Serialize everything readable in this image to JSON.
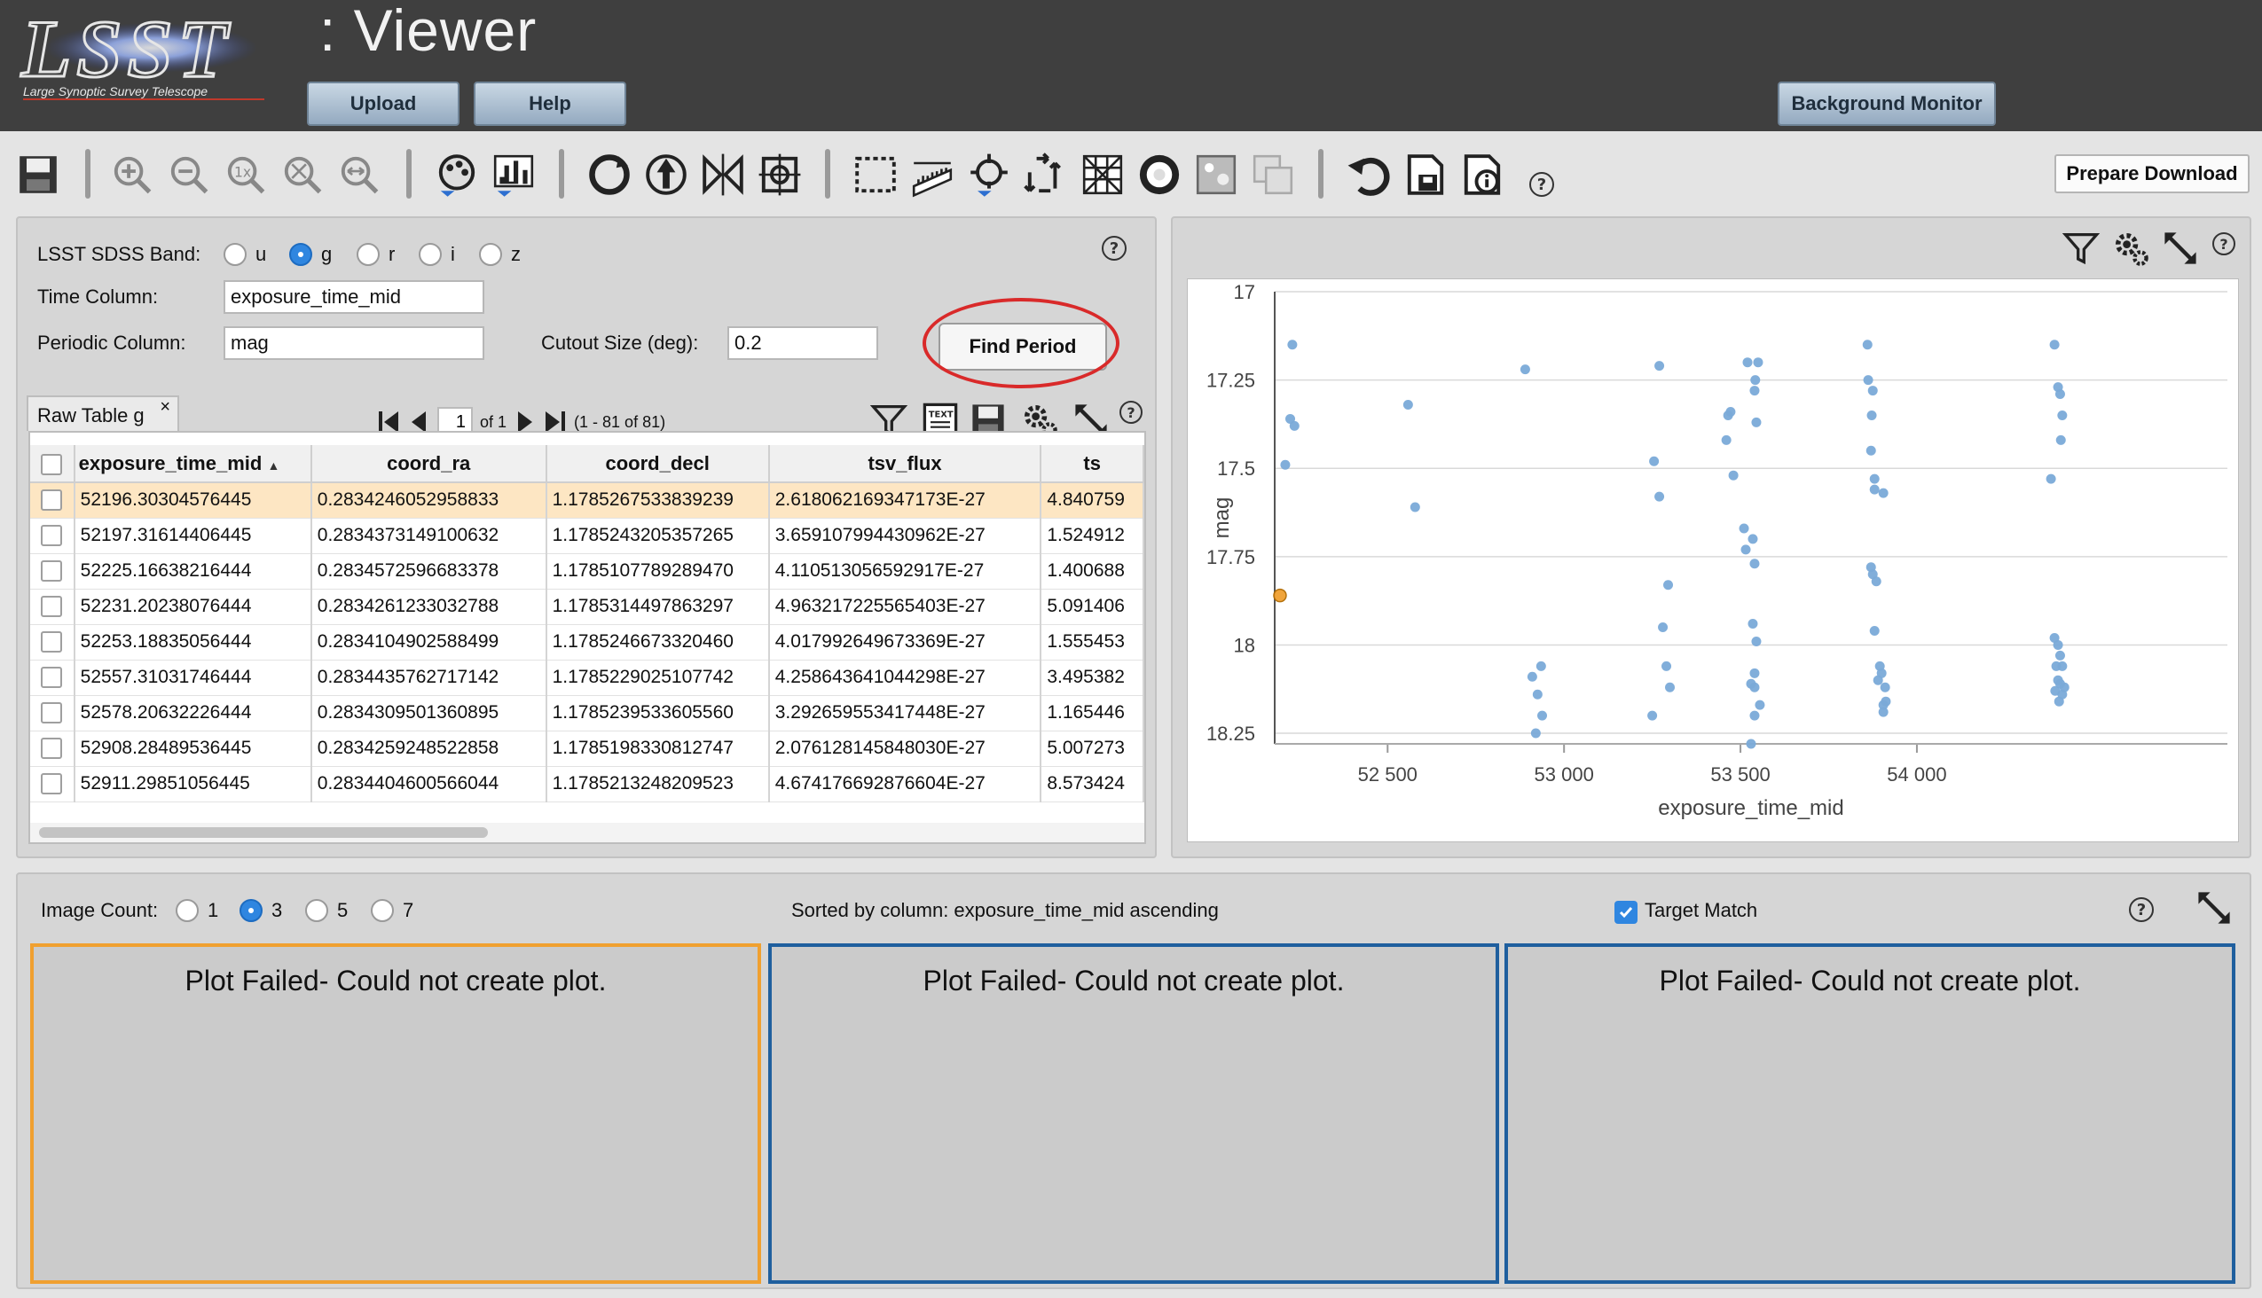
{
  "header": {
    "logo_text": "LSST",
    "logo_tagline": "Large Synoptic Survey Telescope",
    "title": ": Viewer",
    "upload_label": "Upload",
    "help_label": "Help",
    "background_monitor_label": "Background Monitor"
  },
  "toolbar": {
    "icons": [
      "save-icon",
      "zoom-in-icon",
      "zoom-out-icon",
      "zoom-1x-icon",
      "zoom-fit-icon",
      "zoom-fill-icon",
      "color-stretch-icon",
      "histogram-icon",
      "rotate-icon",
      "north-arrow-icon",
      "flip-icon",
      "recenter-icon",
      "select-area-icon",
      "distance-tool-icon",
      "markers-icon",
      "layers-icon",
      "grid-icon",
      "mask-icon",
      "image-icon",
      "overlay-icon",
      "undo-icon",
      "save-region-icon",
      "fits-info-icon",
      "help-icon"
    ],
    "prepare_download_label": "Prepare Download",
    "help_symbol": "?"
  },
  "form": {
    "band_label": "LSST SDSS Band:",
    "bands": [
      "u",
      "g",
      "r",
      "i",
      "z"
    ],
    "selected_band": "g",
    "time_column_label": "Time Column:",
    "time_column_value": "exposure_time_mid",
    "periodic_column_label": "Periodic Column:",
    "periodic_column_value": "mag",
    "cutout_label": "Cutout Size (deg):",
    "cutout_value": "0.2",
    "find_period_label": "Find Period",
    "help_symbol": "?"
  },
  "table": {
    "tab_label": "Raw Table g",
    "tab_close": "×",
    "page_value": "1",
    "page_of": "of 1",
    "range_text": "(1 - 81 of 81)",
    "columns": [
      "exposure_time_mid",
      "coord_ra",
      "coord_decl",
      "tsv_flux",
      "ts"
    ],
    "rows": [
      [
        "52196.30304576445",
        "0.2834246052958833",
        "1.1785267533839239",
        "2.618062169347173E-27",
        "4.840759"
      ],
      [
        "52197.31614406445",
        "0.2834373149100632",
        "1.1785243205357265",
        "3.659107994430962E-27",
        "1.524912"
      ],
      [
        "52225.16638216444",
        "0.2834572596683378",
        "1.1785107789289470",
        "4.110513056592917E-27",
        "1.400688"
      ],
      [
        "52231.20238076444",
        "0.2834261233032788",
        "1.1785314497863297",
        "4.963217225565403E-27",
        "5.091406"
      ],
      [
        "52253.18835056444",
        "0.2834104902588499",
        "1.1785246673320460",
        "4.017992649673369E-27",
        "1.555453"
      ],
      [
        "52557.31031746444",
        "0.2834435762717142",
        "1.1785229025107742",
        "4.258643641044298E-27",
        "3.495382"
      ],
      [
        "52578.20632226444",
        "0.2834309501360895",
        "1.1785239533605560",
        "3.292659553417448E-27",
        "1.165446"
      ],
      [
        "52908.28489536445",
        "0.2834259248522858",
        "1.1785198330812747",
        "2.076128145848030E-27",
        "5.007273"
      ],
      [
        "52911.29851056445",
        "0.2834404600566044",
        "1.1785213248209523",
        "4.674176692876604E-27",
        "8.573424"
      ]
    ],
    "selected_row": 0
  },
  "chart_data": {
    "type": "scatter",
    "xlabel": "exposure_time_mid",
    "ylabel": "mag",
    "xlim": [
      52180,
      54880
    ],
    "ylim": [
      17,
      18.28
    ],
    "y_inverted": true,
    "xticks": [
      52500,
      53000,
      53500,
      54000
    ],
    "xtick_labels": [
      "52 500",
      "53 000",
      "53 500",
      "54 000"
    ],
    "yticks": [
      17,
      17.25,
      17.5,
      17.75,
      18,
      18.25
    ],
    "ytick_labels": [
      "17",
      "17.25",
      "17.5",
      "17.75",
      "18",
      "18.25"
    ],
    "grid": true,
    "series": [
      {
        "color": "#7aaad8",
        "points": [
          [
            52230,
            17.15
          ],
          [
            52224,
            17.36
          ],
          [
            52236,
            17.38
          ],
          [
            52210,
            17.49
          ],
          [
            52558,
            17.32
          ],
          [
            52578,
            17.61
          ],
          [
            52890,
            17.22
          ],
          [
            52910,
            18.09
          ],
          [
            52935,
            18.06
          ],
          [
            52925,
            18.14
          ],
          [
            52938,
            18.2
          ],
          [
            52920,
            18.25
          ],
          [
            53270,
            17.21
          ],
          [
            53255,
            17.48
          ],
          [
            53270,
            17.58
          ],
          [
            53295,
            17.83
          ],
          [
            53280,
            17.95
          ],
          [
            53290,
            18.06
          ],
          [
            53300,
            18.12
          ],
          [
            53250,
            18.2
          ],
          [
            53465,
            17.35
          ],
          [
            53472,
            17.34
          ],
          [
            53460,
            17.42
          ],
          [
            53480,
            17.52
          ],
          [
            53510,
            17.67
          ],
          [
            53515,
            17.73
          ],
          [
            53535,
            17.7
          ],
          [
            53540,
            17.77
          ],
          [
            53535,
            17.94
          ],
          [
            53545,
            17.99
          ],
          [
            53540,
            18.08
          ],
          [
            53530,
            18.11
          ],
          [
            53540,
            18.12
          ],
          [
            53555,
            18.17
          ],
          [
            53540,
            18.2
          ],
          [
            53530,
            18.28
          ],
          [
            53520,
            17.2
          ],
          [
            53540,
            17.28
          ],
          [
            53542,
            17.25
          ],
          [
            53550,
            17.2
          ],
          [
            53545,
            17.37
          ],
          [
            53860,
            17.15
          ],
          [
            53875,
            17.28
          ],
          [
            53862,
            17.25
          ],
          [
            53870,
            17.45
          ],
          [
            53872,
            17.35
          ],
          [
            53880,
            17.53
          ],
          [
            53880,
            17.56
          ],
          [
            53905,
            17.57
          ],
          [
            53870,
            17.78
          ],
          [
            53875,
            17.8
          ],
          [
            53885,
            17.82
          ],
          [
            53880,
            17.96
          ],
          [
            53895,
            18.06
          ],
          [
            53900,
            18.08
          ],
          [
            53910,
            18.12
          ],
          [
            53912,
            18.16
          ],
          [
            53905,
            18.19
          ],
          [
            53905,
            18.17
          ],
          [
            53890,
            18.1
          ],
          [
            54390,
            17.15
          ],
          [
            54400,
            17.27
          ],
          [
            54406,
            17.29
          ],
          [
            54412,
            17.35
          ],
          [
            54380,
            17.53
          ],
          [
            54408,
            17.42
          ],
          [
            54390,
            17.98
          ],
          [
            54400,
            18.0
          ],
          [
            54406,
            18.03
          ],
          [
            54412,
            18.06
          ],
          [
            54400,
            18.1
          ],
          [
            54406,
            18.11
          ],
          [
            54392,
            18.13
          ],
          [
            54403,
            18.16
          ],
          [
            54412,
            18.14
          ],
          [
            54418,
            18.12
          ],
          [
            54395,
            18.06
          ]
        ]
      },
      {
        "color": "#f0a030",
        "points": [
          [
            52195,
            17.86
          ]
        ]
      }
    ]
  },
  "bottom": {
    "image_count_label": "Image Count:",
    "counts": [
      "1",
      "3",
      "5",
      "7"
    ],
    "selected_count": "3",
    "sort_text": "Sorted by column: exposure_time_mid ascending",
    "target_match_label": "Target Match",
    "target_match_checked": true,
    "help_symbol": "?",
    "cells": [
      {
        "message": "Plot Failed- Could not create plot."
      },
      {
        "message": "Plot Failed- Could not create plot."
      },
      {
        "message": "Plot Failed- Could not create plot."
      }
    ]
  }
}
